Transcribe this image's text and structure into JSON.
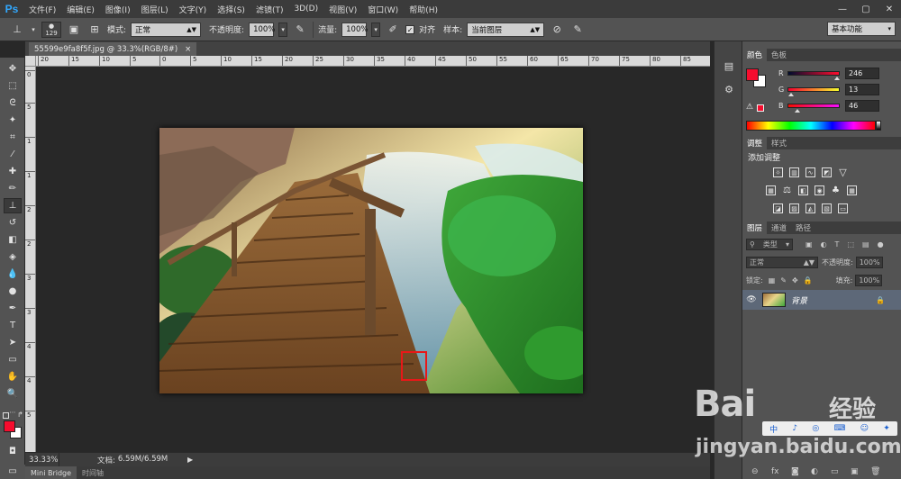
{
  "app": {
    "logo": "Ps",
    "menu": [
      "文件(F)",
      "编辑(E)",
      "图像(I)",
      "图层(L)",
      "文字(Y)",
      "选择(S)",
      "滤镜(T)",
      "3D(D)",
      "视图(V)",
      "窗口(W)",
      "帮助(H)"
    ],
    "window_buttons": [
      "—",
      "▢",
      "✕"
    ]
  },
  "options_bar": {
    "brush_size": "129",
    "mode_label": "模式:",
    "mode_value": "正常",
    "opacity_label": "不透明度:",
    "opacity_value": "100%",
    "flow_label": "流量:",
    "flow_value": "100%",
    "aligned_label": "对齐",
    "aligned_checked": "✓",
    "sample_label": "样本:",
    "sample_value": "当前图层",
    "workspace": "基本功能"
  },
  "document": {
    "tab_title": "55599e9fa8f5f.jpg @ 33.3%(RGB/8#)",
    "tab_close": "×",
    "zoom": "33.33%",
    "doc_label": "文档:",
    "doc_size": "6.59M/6.59M",
    "ruler_top": [
      "20",
      "15",
      "10",
      "5",
      "0",
      "5",
      "10",
      "15",
      "20",
      "25",
      "30",
      "35",
      "40",
      "45",
      "50",
      "55",
      "60",
      "65",
      "70",
      "75",
      "80",
      "85"
    ],
    "ruler_left": [
      "0",
      "5",
      "1",
      "1",
      "2",
      "2",
      "3",
      "3",
      "4",
      "4",
      "5"
    ]
  },
  "bottom_tabs": [
    "Mini Bridge",
    "时间轴"
  ],
  "panels": {
    "color_tabs": [
      "颜色",
      "色板"
    ],
    "color": {
      "r_label": "R",
      "r_value": "246",
      "r_fraction": 0.965,
      "g_label": "G",
      "g_value": "13",
      "g_fraction": 0.05,
      "b_label": "B",
      "b_value": "46",
      "b_fraction": 0.18,
      "foreground": "#f60d2e",
      "background": "#ffffff"
    },
    "adjust_tabs": [
      "调整",
      "样式"
    ],
    "adjust_title": "添加调整",
    "layers_tabs": [
      "图层",
      "通道",
      "路径"
    ],
    "layers": {
      "filter_label": "类型",
      "blend_mode": "正常",
      "opacity_label": "不透明度:",
      "opacity_value": "100%",
      "lock_label": "锁定:",
      "fill_label": "填充:",
      "fill_value": "100%",
      "layer_name": "背景"
    }
  },
  "watermark": {
    "logo": "Bai",
    "logo_tail": "经验",
    "url": "jingyan.baidu.com",
    "ime": [
      "中",
      "♪",
      "◎",
      "⌨",
      "☺",
      "✦"
    ]
  },
  "colors": {
    "accent_ps": "#31a8ff",
    "selection_box": "#e81818",
    "layer_selected": "#5d6878"
  }
}
